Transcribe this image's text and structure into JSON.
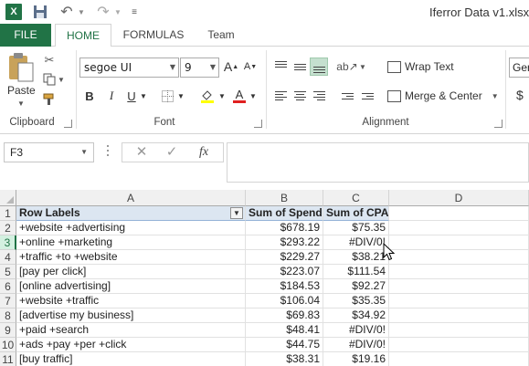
{
  "window": {
    "doc_title": "Iferror Data v1.xlsx",
    "app_icon": "excel-logo-icon",
    "app_icon_letter": "X"
  },
  "ribbon_tabs": [
    "FILE",
    "HOME",
    "FORMULAS",
    "Team"
  ],
  "ribbon": {
    "clipboard": {
      "paste_label": "Paste",
      "group_label": "Clipboard"
    },
    "font": {
      "font_name": "segoe UI",
      "font_size": "9",
      "bold": "B",
      "italic": "I",
      "underline": "U",
      "grow": "A",
      "shrink": "A",
      "font_color_letter": "A",
      "group_label": "Font"
    },
    "alignment": {
      "wrap_text": "Wrap Text",
      "merge_center": "Merge & Center",
      "group_label": "Alignment"
    },
    "number": {
      "format": "Gen",
      "currency": "$"
    }
  },
  "formula_bar": {
    "name_box": "F3",
    "cancel": "✕",
    "enter": "✓",
    "fx": "fx",
    "value": ""
  },
  "sheet": {
    "columns": [
      "A",
      "B",
      "C",
      "D"
    ],
    "header_row": {
      "row": "1",
      "a": "Row Labels",
      "b": "Sum of Spend",
      "c": "Sum of CPA"
    },
    "rows": [
      {
        "row": "2",
        "a": " +website +advertising",
        "b": "$678.19",
        "c": "$75.35"
      },
      {
        "row": "3",
        "a": " +online +marketing",
        "b": "$293.22",
        "c": "#DIV/0!"
      },
      {
        "row": "4",
        "a": " +traffic +to +website",
        "b": "$229.27",
        "c": "$38.21"
      },
      {
        "row": "5",
        "a": "[pay per click]",
        "b": "$223.07",
        "c": "$111.54"
      },
      {
        "row": "6",
        "a": "[online advertising]",
        "b": "$184.53",
        "c": "$92.27"
      },
      {
        "row": "7",
        "a": " +website +traffic",
        "b": "$106.04",
        "c": "$35.35"
      },
      {
        "row": "8",
        "a": "[advertise my business]",
        "b": "$69.83",
        "c": "$34.92"
      },
      {
        "row": "9",
        "a": " +paid +search",
        "b": "$48.41",
        "c": "#DIV/0!"
      },
      {
        "row": "10",
        "a": " +ads +pay +per +click",
        "b": "$44.75",
        "c": "#DIV/0!"
      },
      {
        "row": "11",
        "a": "[buy traffic]",
        "b": "$38.31",
        "c": "$19.16"
      }
    ],
    "selected_row": "3"
  },
  "colors": {
    "accent": "#217346",
    "pivot_header": "#dce6f1",
    "selection_header": "#d3f0e0"
  }
}
